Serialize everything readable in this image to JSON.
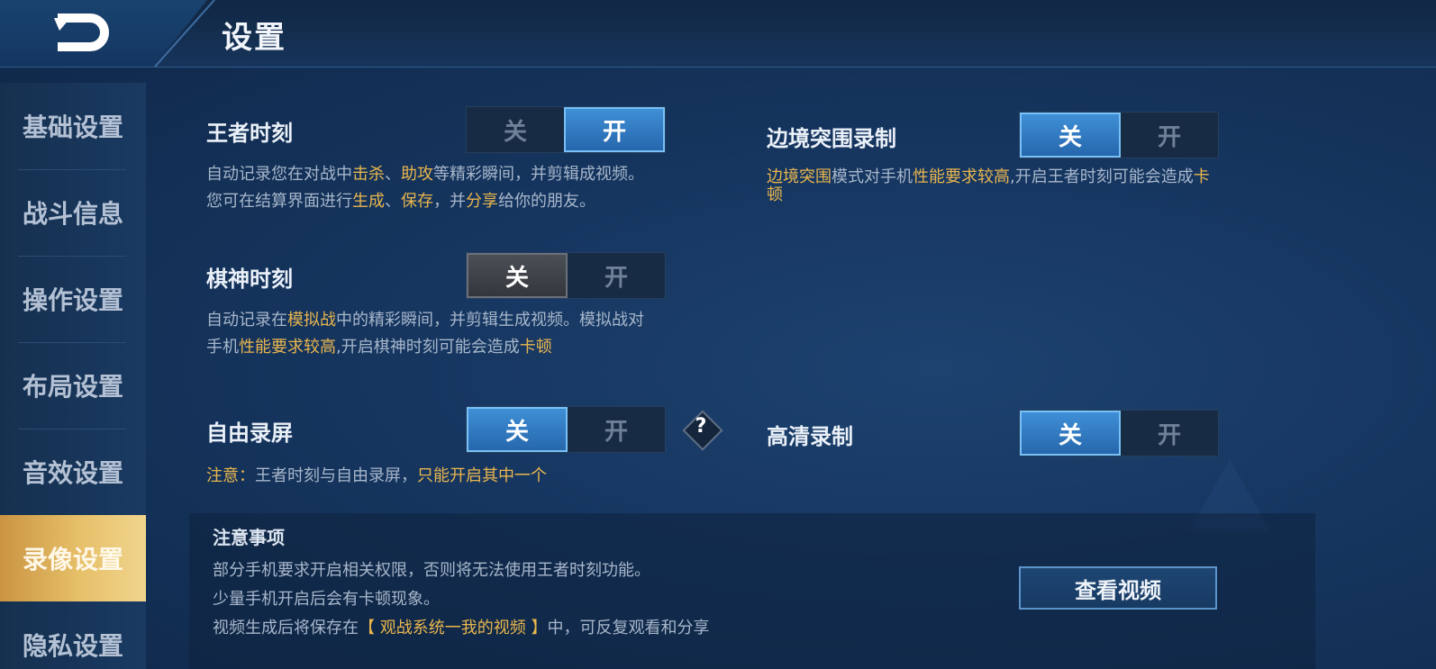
{
  "header": {
    "title": "设置",
    "back_icon": "back-arrow-icon"
  },
  "sidebar": {
    "items": [
      {
        "label": "基础设置",
        "active": false
      },
      {
        "label": "战斗信息",
        "active": false
      },
      {
        "label": "操作设置",
        "active": false
      },
      {
        "label": "布局设置",
        "active": false
      },
      {
        "label": "音效设置",
        "active": false
      },
      {
        "label": "录像设置",
        "active": true
      },
      {
        "label": "隐私设置",
        "active": false
      }
    ]
  },
  "settings": {
    "wangzhe": {
      "label": "王者时刻",
      "off": "关",
      "on": "开",
      "selected": "on",
      "desc_line1": {
        "t1": "自动记录您在对战中",
        "h1": "击杀",
        "t2": "、",
        "h2": "助攻",
        "t3": "等精彩瞬间，并剪辑成视频。"
      },
      "desc_line2": {
        "t1": "您可在结算界面进行",
        "h1": "生成",
        "t2": "、",
        "h2": "保存",
        "t3": "，并",
        "h3": "分享",
        "t4": "给你的朋友。"
      }
    },
    "qishen": {
      "label": "棋神时刻",
      "off": "关",
      "on": "开",
      "selected": "off",
      "desc_line1": {
        "t1": "自动记录在",
        "h1": "模拟战",
        "t2": "中的精彩瞬间，并剪辑生成视频。模拟战对"
      },
      "desc_line2": {
        "t1": "手机",
        "h1": "性能要求较高",
        "t2": ",开启棋神时刻可能会造成",
        "h2": "卡顿"
      }
    },
    "free_record": {
      "label": "自由录屏",
      "off": "关",
      "on": "开",
      "selected": "off",
      "help": "?",
      "note": {
        "h1": "注意：",
        "t1": "王者时刻与自由录屏，",
        "h2": "只能开启其中一个"
      }
    },
    "border": {
      "label": "边境突围录制",
      "off": "关",
      "on": "开",
      "selected": "off",
      "desc_line1": {
        "h1": "边境突围",
        "t1": "模式对手机",
        "h2": "性能要求较高",
        "t2": ",开启王者时刻可能会造成",
        "h3": "卡"
      },
      "desc_line2": {
        "h1": "顿"
      }
    },
    "hd": {
      "label": "高清录制",
      "off": "关",
      "on": "开",
      "selected": "off"
    }
  },
  "notice": {
    "title": "注意事项",
    "line1": "部分手机要求开启相关权限，否则将无法使用王者时刻功能。",
    "line2": "少量手机开启后会有卡顿现象。",
    "line3": {
      "t1": "视频生成后将保存在",
      "h1": "【 观战系统一我的视频 】",
      "t2": "中，可反复观看和分享"
    }
  },
  "view_video_button": "查看视频",
  "colors": {
    "highlight": "#e9b64e",
    "toggle_blue": "#2f7bc4",
    "sidebar_active": "#dcae57"
  }
}
